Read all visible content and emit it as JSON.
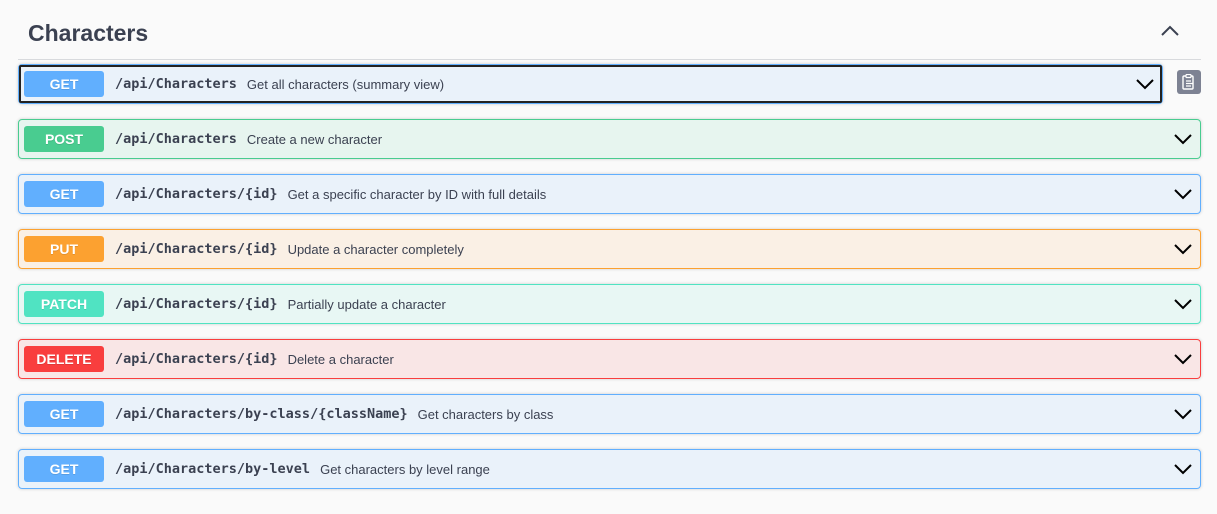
{
  "section": {
    "title": "Characters",
    "collapse_icon": "chevron-up-icon"
  },
  "operations": [
    {
      "method": "GET",
      "path": "/api/Characters",
      "description": "Get all characters (summary view)",
      "color": "#61affe"
    },
    {
      "method": "POST",
      "path": "/api/Characters",
      "description": "Create a new character",
      "color": "#49cc90"
    },
    {
      "method": "GET",
      "path": "/api/Characters/{id}",
      "description": "Get a specific character by ID with full details",
      "color": "#61affe"
    },
    {
      "method": "PUT",
      "path": "/api/Characters/{id}",
      "description": "Update a character completely",
      "color": "#fca130"
    },
    {
      "method": "PATCH",
      "path": "/api/Characters/{id}",
      "description": "Partially update a character",
      "color": "#50e3c2"
    },
    {
      "method": "DELETE",
      "path": "/api/Characters/{id}",
      "description": "Delete a character",
      "color": "#f93e3e"
    },
    {
      "method": "GET",
      "path": "/api/Characters/by-class/{className}",
      "description": "Get characters by class",
      "color": "#61affe"
    },
    {
      "method": "GET",
      "path": "/api/Characters/by-level",
      "description": "Get characters by level range",
      "color": "#61affe"
    }
  ],
  "icons": {
    "expand": "chevron-down-icon",
    "copy": "clipboard-copy-icon"
  }
}
